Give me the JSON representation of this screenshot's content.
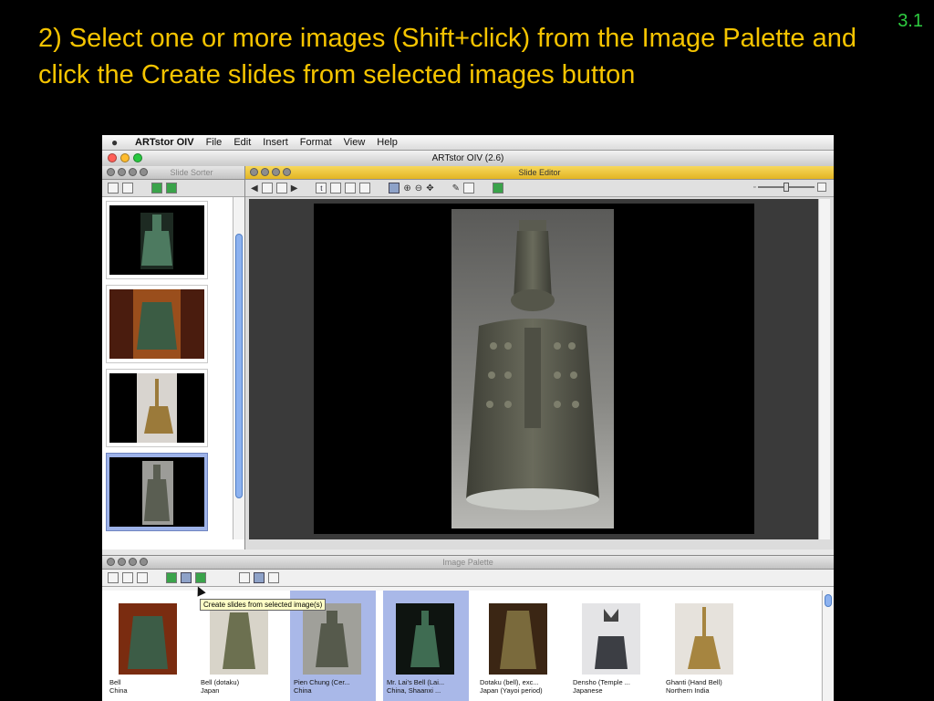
{
  "slide": {
    "number": "3.1",
    "headline": "2) Select one or more images (Shift+click) from the Image Palette and click the Create slides from selected images button"
  },
  "app": {
    "menu": [
      "ARTstor OIV",
      "File",
      "Edit",
      "Insert",
      "Format",
      "View",
      "Help"
    ],
    "window_title": "ARTstor OIV (2.6)"
  },
  "panels": {
    "slide_sorter": "Slide Sorter",
    "slide_editor": "Slide Editor",
    "image_palette": "Image Palette"
  },
  "tooltip": "Create slides from selected image(s)",
  "palette_items": [
    {
      "title": "Bell",
      "subtitle": "China",
      "selected": false
    },
    {
      "title": "Bell (dotaku)",
      "subtitle": "Japan",
      "selected": false
    },
    {
      "title": "Pien Chung (Cer...",
      "subtitle": "China",
      "selected": true
    },
    {
      "title": "Mr. Lai's Bell (Lai...",
      "subtitle": "China, Shaanxi ...",
      "selected": true
    },
    {
      "title": "Dotaku (bell), exc...",
      "subtitle": "Japan (Yayoi period)",
      "selected": false
    },
    {
      "title": "Densho (Temple ...",
      "subtitle": "Japanese",
      "selected": false
    },
    {
      "title": "Ghanti (Hand Bell)",
      "subtitle": "Northern India",
      "selected": false
    }
  ],
  "colors": {
    "headline": "#f5c400",
    "slide_number": "#2ecc40",
    "selection": "#a9b8e8"
  }
}
